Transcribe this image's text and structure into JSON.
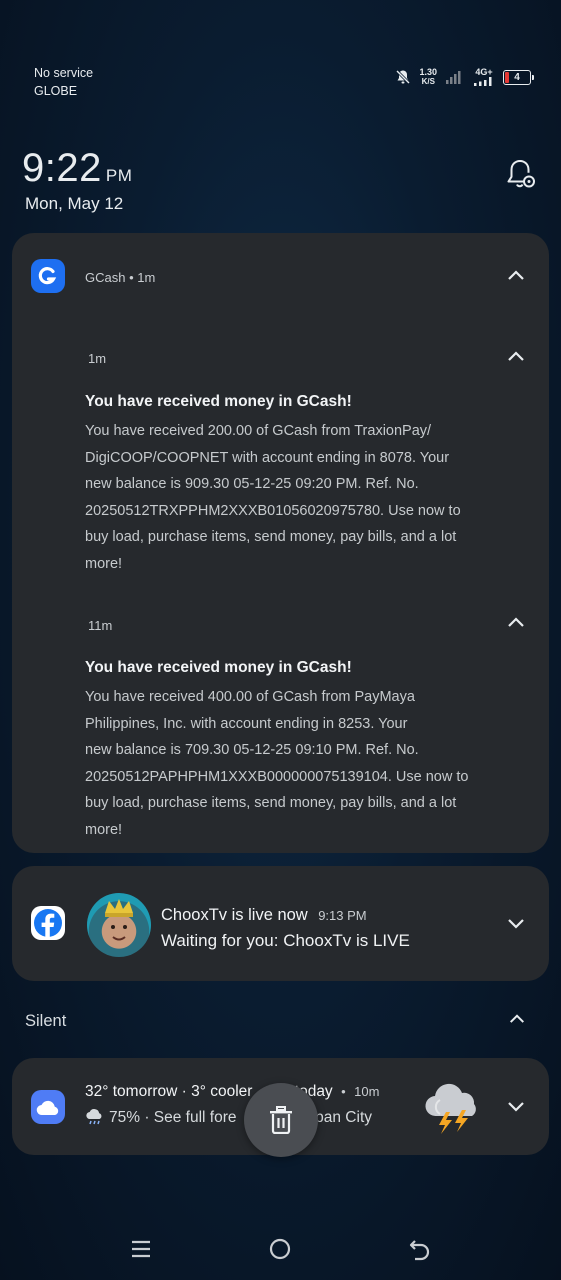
{
  "status_bar": {
    "carrier_line1": "No service",
    "carrier_line2": "GLOBE",
    "speed_value": "1.30",
    "speed_unit": "K/S",
    "network": "4G+",
    "battery": "4"
  },
  "lockscreen": {
    "time": "9:22",
    "ampm": "PM",
    "date": "Mon, May 12"
  },
  "gcash_group": {
    "app_name": "GCash",
    "time": "1m",
    "items": [
      {
        "time": "1m",
        "title": "You have received money in GCash!",
        "lines": [
          "You have received 200.00 of GCash from TraxionPay/",
          "DigiCOOP/COOPNET with account ending in 8078. Your",
          "new balance is 909.30 05-12-25 09:20 PM. Ref. No.",
          "20250512TRXPPHM2XXXB01056020975780. Use now to",
          "buy load, purchase items, send money, pay bills, and a lot",
          "more!"
        ]
      },
      {
        "time": "11m",
        "title": "You have received money in GCash!",
        "lines": [
          "You have received 400.00 of GCash from PayMaya",
          "Philippines, Inc. with account ending in 8253. Your",
          "new balance is 709.30 05-12-25 09:10 PM. Ref. No.",
          "20250512PAPHPHM1XXXB000000075139104. Use now to",
          "buy load, purchase items, send money, pay bills, and a lot",
          "more!"
        ]
      }
    ]
  },
  "facebook_notif": {
    "title": "ChooxTv is live now",
    "time": "9:13 PM",
    "subtitle": "Waiting for you: ChooxTv is LIVE"
  },
  "silent_section": {
    "label": "Silent"
  },
  "weather_notif": {
    "title_a": "32° tomorrow · 3° cooler ",
    "title_b": "today",
    "time": "10m",
    "sub_a": "75% · See full fore",
    "sub_b": "apan City"
  },
  "colors": {
    "gcash_blue": "#1e6ff1",
    "weather_blue": "#4f7cf5",
    "battery_red": "#e53935",
    "card_bg": "#26292d"
  },
  "icons": [
    "mute-bell-icon",
    "signal-icon",
    "battery-icon",
    "notification-settings-icon",
    "gcash-logo-icon",
    "facebook-logo-icon",
    "weather-app-icon",
    "thunderstorm-icon",
    "rain-icon",
    "trash-icon",
    "menu-icon",
    "home-icon",
    "back-icon",
    "chevron-up-icon",
    "chevron-down-icon"
  ]
}
